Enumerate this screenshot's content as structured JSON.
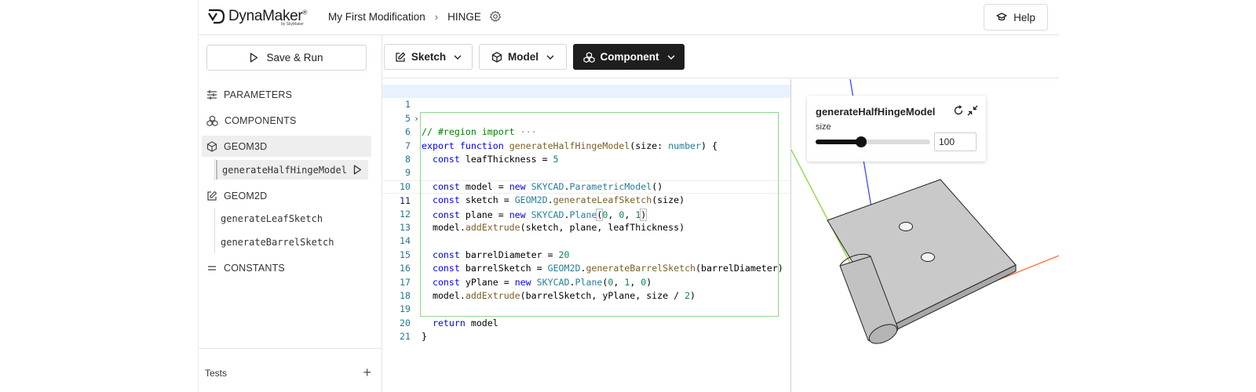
{
  "header": {
    "logo_text": "DynaMaker",
    "logo_sub": "by SkyMaker",
    "breadcrumb_project": "My First Modification",
    "breadcrumb_component": "HINGE",
    "help_label": "Help"
  },
  "sidebar": {
    "save_run_label": "Save & Run",
    "sections": {
      "parameters": "PARAMETERS",
      "components": "COMPONENTS",
      "geom3d": "GEOM3D",
      "geom3d_items": [
        "generateHalfHingeModel"
      ],
      "geom2d": "GEOM2D",
      "geom2d_items": [
        "generateLeafSketch",
        "generateBarrelSketch"
      ],
      "constants": "CONSTANTS"
    },
    "tests_label": "Tests"
  },
  "toolbar": {
    "sketch_label": "Sketch",
    "model_label": "Model",
    "component_label": "Component"
  },
  "editor": {
    "line_numbers": [
      "1",
      "5",
      "6",
      "7",
      "8",
      "9",
      "10",
      "11",
      "12",
      "13",
      "14",
      "15",
      "16",
      "17",
      "18",
      "19",
      "20",
      "21"
    ],
    "current_line": "11"
  },
  "viewer": {
    "panel_title": "generateHalfHingeModel",
    "param_label": "size",
    "param_value": "100",
    "slider_fraction": 0.4
  },
  "colors": {
    "accent_dark": "#1e1e1e",
    "keyword": "#0000ff",
    "comment": "#008000",
    "number": "#098658",
    "class": "#267f99",
    "function": "#795e26",
    "axis_x": "#ff5a1f",
    "axis_y": "#7cd629",
    "axis_z": "#2a3cff"
  }
}
